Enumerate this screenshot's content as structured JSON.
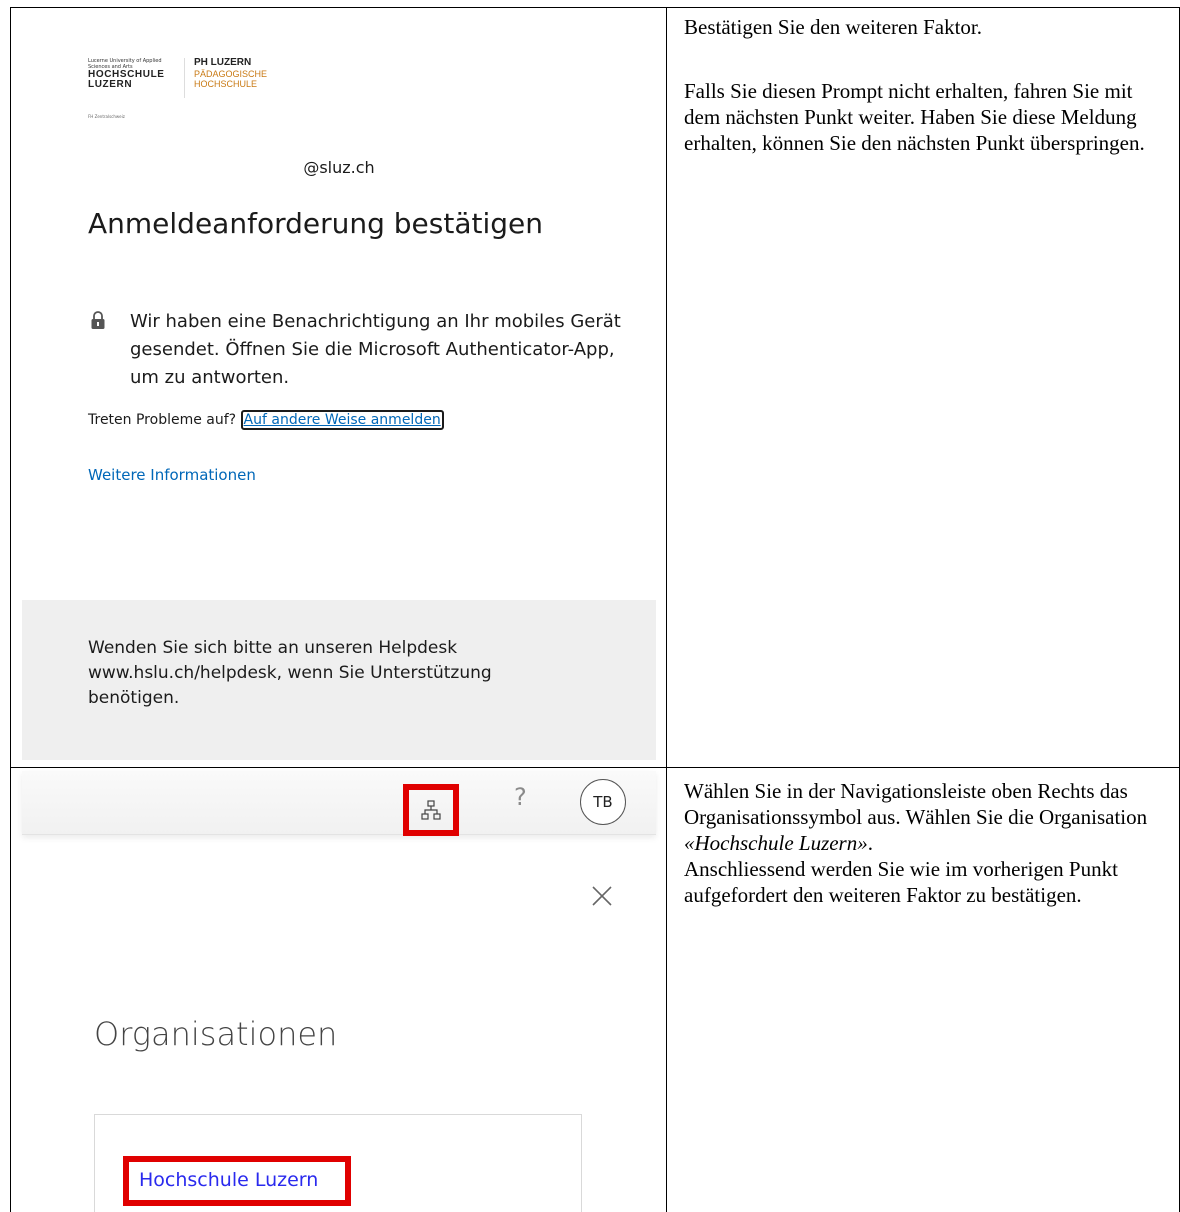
{
  "login": {
    "logo": {
      "hslu_small": "Lucerne University of Applied Sciences and Arts",
      "hslu_main_1": "HOCHSCHULE",
      "hslu_main_2": "LUZERN",
      "hslu_sub": "FH Zentralschweiz",
      "ph_main": "PH LUZERN",
      "ph_sub_1": "PÄDAGOGISCHE",
      "ph_sub_2": "HOCHSCHULE"
    },
    "email": "@sluz.ch",
    "title": "Anmeldeanforderung bestätigen",
    "notice": "Wir haben eine Benachrichtigung an Ihr mobiles Gerät gesendet. Öffnen Sie die Microsoft Authenticator-App, um zu antworten.",
    "trouble_prefix": "Treten Probleme auf?",
    "trouble_link": "Auf andere Weise anmelden",
    "more_info": "Weitere Informationen",
    "helpdesk_text": "Wenden Sie sich bitte an unseren Helpdesk www.hslu.ch/helpdesk, wenn Sie Unterstützung benötigen."
  },
  "orgs": {
    "help_glyph": "?",
    "avatar_initials": "TB",
    "heading": "Organisationen",
    "org_name": "Hochschule Luzern",
    "highlight_color": "#e00000",
    "icons": [
      "organization-icon",
      "help-icon",
      "close-icon",
      "lock-icon"
    ]
  },
  "instructions": {
    "step1_line1": "Bestätigen Sie den weiteren Faktor.",
    "step1_line2": "Falls Sie diesen Prompt nicht erhalten, fahren Sie mit dem nächsten Punkt weiter. Haben Sie diese Meldung erhalten, können Sie den nächsten Punkt überspringen.",
    "step2_part1": "Wählen Sie in der Navigationsleiste oben Rechts das Organisationssymbol aus. Wählen Sie die Organisation ",
    "step2_org": "«Hochschule Luzern»",
    "step2_part2": ".",
    "step2_part3": "Anschliessend werden Sie wie im vorherigen Punkt aufgefordert den weiteren Faktor zu bestätigen."
  }
}
